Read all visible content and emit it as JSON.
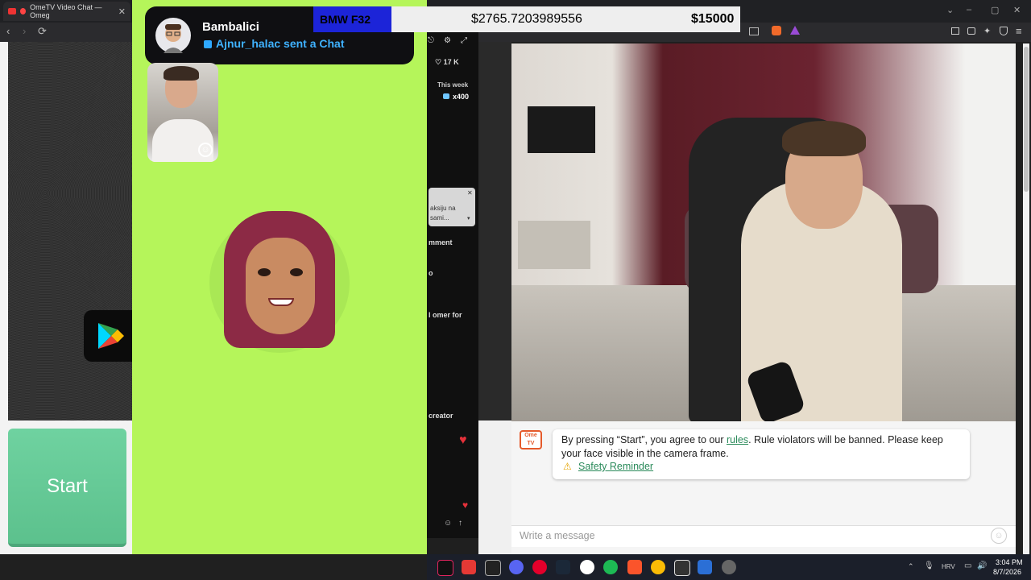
{
  "browser": {
    "tab_title": "OmeTV Video Chat — Omeg",
    "tab_close": "✕",
    "nav_back": "‹",
    "nav_forward": "›",
    "nav_reload": "⟳"
  },
  "notification": {
    "sender": "Bambalici",
    "message": "Ajnur_halac sent a Chat"
  },
  "overlay": {
    "car_label": "BMW F32",
    "current_amount": "$2765.7203989556",
    "target_amount": "$15000"
  },
  "tiktok": {
    "likes": "♡ 17 K",
    "week_label": "This week",
    "gift_count": "x400",
    "popup_text": "aksiju na sami...",
    "popup_close": "✕",
    "comment_label": "mment",
    "o_label": "o",
    "omer_label": "l omer for",
    "creator_label": "creator"
  },
  "left_panel": {
    "start_label": "Start"
  },
  "ome": {
    "logo_text": "Ome TV",
    "message_prefix": "By pressing “Start”, you agree to our ",
    "rules_link": "rules",
    "message_suffix": ". Rule violators will be banned. Please keep your face visible in the camera frame.",
    "safety_link": "Safety Reminder",
    "input_placeholder": "Write a message"
  },
  "taskbar": {
    "lang": "HRV",
    "time": "3:04 PM",
    "date": "8/7/2026"
  },
  "colors": {
    "snap_green": "#b5f55a",
    "start_green": "#6fd2a0",
    "overlay_blue": "#1c24d8",
    "link_green": "#2a8a5a"
  }
}
